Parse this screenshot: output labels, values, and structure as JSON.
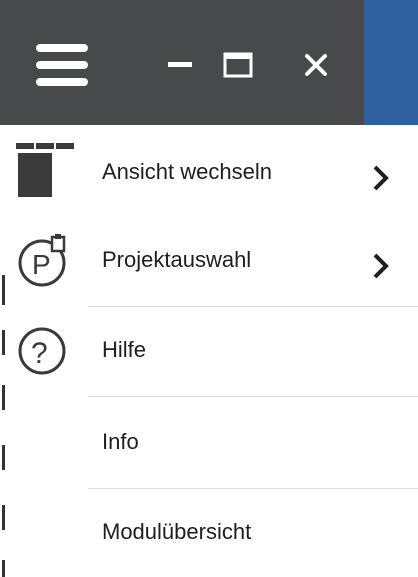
{
  "titlebar": {
    "background": "#48494b",
    "accent": "#2f5f9e",
    "buttons": {
      "menu": "hamburger-menu-icon",
      "minimize": "minimize-icon",
      "maximize": "maximize-icon",
      "close": "close-icon"
    }
  },
  "menu": {
    "items": [
      {
        "label": "Ansicht wechseln",
        "icon": "layout-switch-icon",
        "has_submenu": true
      },
      {
        "label": "Projektauswahl",
        "icon": "project-select-icon",
        "has_submenu": true
      },
      {
        "label": "Hilfe",
        "icon": "help-icon",
        "has_submenu": false
      },
      {
        "label": "Info",
        "icon": "",
        "has_submenu": false
      },
      {
        "label": "Modulübersicht",
        "icon": "",
        "has_submenu": false
      }
    ]
  }
}
